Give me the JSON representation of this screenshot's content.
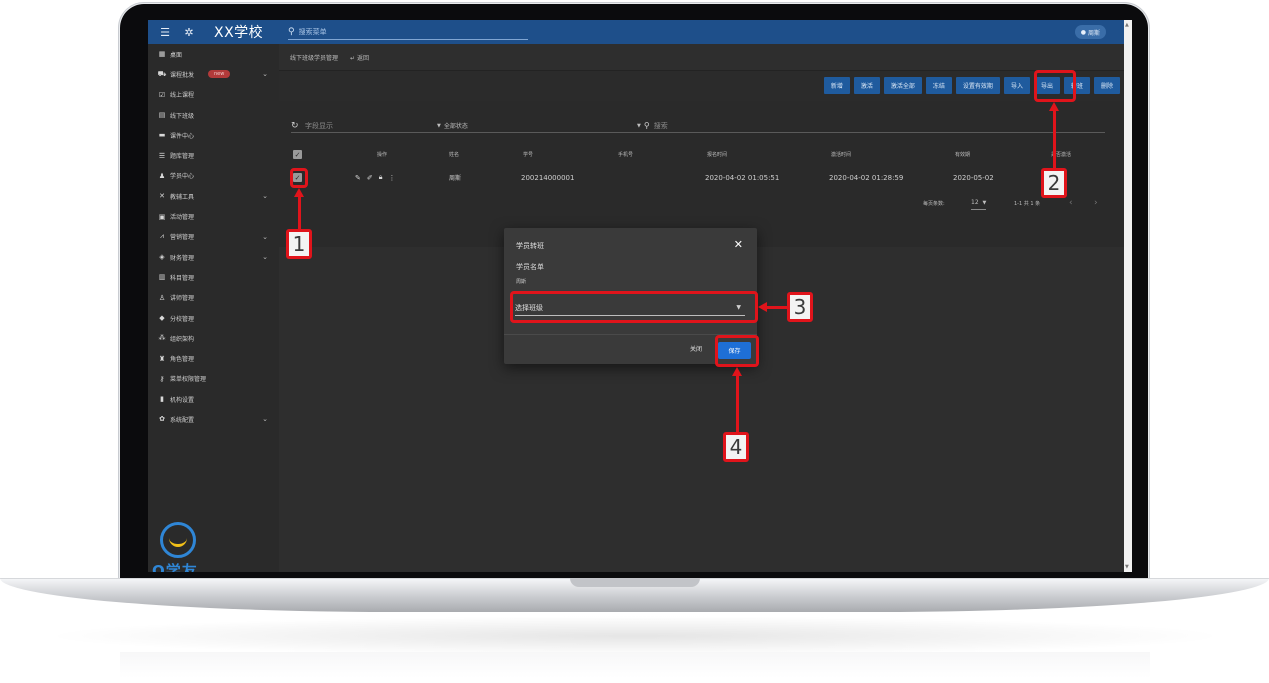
{
  "topbar": {
    "menu_icon": "☰",
    "settings_icon": "✲",
    "title": "XX学校",
    "search_placeholder": "搜索菜单",
    "user": "周斯"
  },
  "sidebar": {
    "items": [
      {
        "label": "桌面",
        "icon": "grid-icon"
      },
      {
        "label": "课程批发",
        "icon": "cart-icon",
        "badge": "new",
        "expandable": true
      },
      {
        "label": "线上课程",
        "icon": "checkbox-icon"
      },
      {
        "label": "线下班级",
        "icon": "card-icon"
      },
      {
        "label": "课件中心",
        "icon": "folder-icon"
      },
      {
        "label": "题库管理",
        "icon": "list-icon"
      },
      {
        "label": "学员中心",
        "icon": "student-icon"
      },
      {
        "label": "教辅工具",
        "icon": "tools-icon",
        "expandable": true
      },
      {
        "label": "活动管理",
        "icon": "gift-icon"
      },
      {
        "label": "营销管理",
        "icon": "chart-icon",
        "expandable": true
      },
      {
        "label": "财务管理",
        "icon": "money-icon",
        "expandable": true
      },
      {
        "label": "科目管理",
        "icon": "book-icon"
      },
      {
        "label": "讲师管理",
        "icon": "teacher-icon"
      },
      {
        "label": "分校管理",
        "icon": "layers-icon"
      },
      {
        "label": "组织架构",
        "icon": "org-icon"
      },
      {
        "label": "角色管理",
        "icon": "role-icon"
      },
      {
        "label": "菜单权限管理",
        "icon": "key-icon"
      },
      {
        "label": "机构设置",
        "icon": "building-icon"
      },
      {
        "label": "系统配置",
        "icon": "gear-icon",
        "expandable": true
      }
    ],
    "logo_text": "Q学友"
  },
  "breadcrumb": {
    "current": "线下班级学员管理",
    "back": "返回"
  },
  "toolbar": {
    "buttons": [
      "新增",
      "激活",
      "激活全部",
      "冻结",
      "设置有效期",
      "导入",
      "导出",
      "转班",
      "删除"
    ]
  },
  "filters": {
    "field_placeholder": "字段显示",
    "status": "全部状态",
    "search_placeholder": "搜索"
  },
  "table": {
    "headers": [
      "操作",
      "姓名",
      "学号",
      "手机号",
      "报名时间",
      "激活时间",
      "有效期",
      "是否激活"
    ],
    "rows": [
      {
        "checked": true,
        "name": "周斯",
        "student_no": "200214000001",
        "phone": "",
        "signup_time": "2020-04-02 01:05:51",
        "activate_time": "2020-04-02 01:28:59",
        "valid_until": "2020-05-02",
        "active": ""
      }
    ]
  },
  "pager": {
    "per_page_label": "每页条数:",
    "per_page": "12",
    "range": "1-1 共 1 条",
    "prev": "‹",
    "next": "›"
  },
  "dialog": {
    "title": "学员转班",
    "list_label": "学员名单",
    "student": "周斯",
    "select_placeholder": "选择班级",
    "close_label": "关闭",
    "save_label": "保存"
  },
  "annotations": {
    "labels": [
      "1",
      "2",
      "3",
      "4"
    ],
    "color": "#e0141b"
  },
  "colors": {
    "topbar": "#1e4f8a",
    "button": "#1f5b9e",
    "save": "#1e6fd6",
    "badge": "#b23a3a"
  }
}
